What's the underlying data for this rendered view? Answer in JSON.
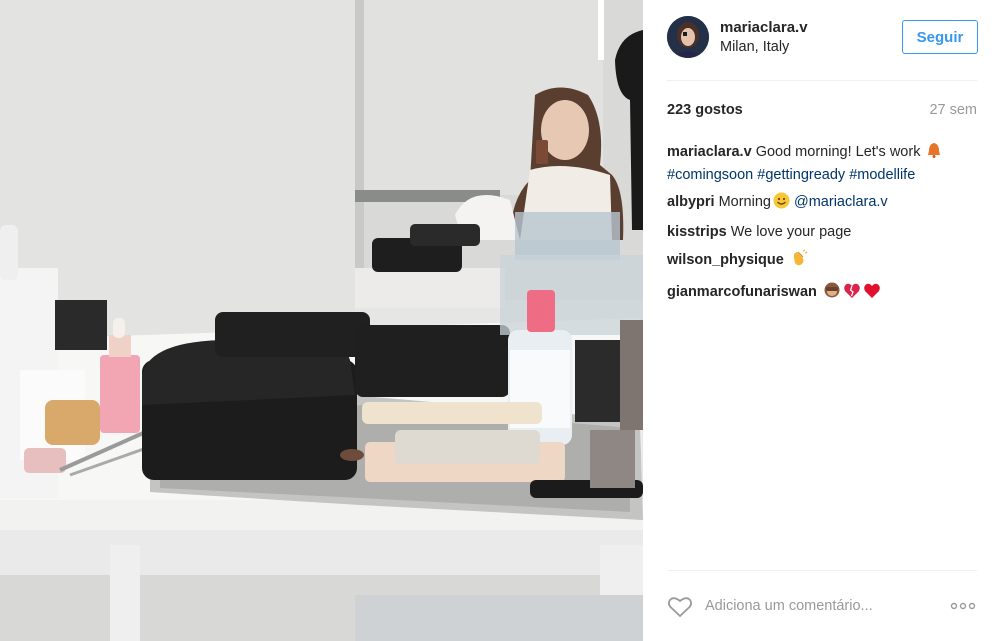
{
  "post": {
    "author": {
      "username": "mariaclara.v",
      "location": "Milan, Italy"
    },
    "follow_label": "Seguir",
    "likes_text": "223 gostos",
    "time_ago": "27 sem",
    "caption": {
      "user": "mariaclara.v",
      "text": "Good morning! Let's work",
      "hashtags": [
        "#comingsoon",
        "#getting­ready",
        "#modellife"
      ]
    },
    "comments": [
      {
        "user": "albypri",
        "text": "Morning",
        "mention": "@mariaclara.v"
      },
      {
        "user": "kisstrips",
        "text": "We love your page"
      },
      {
        "user": "wilson_physique",
        "text": ""
      },
      {
        "user": "gianmarcofunariswan",
        "text": ""
      }
    ],
    "add_comment_placeholder": "Adiciona um comentário...",
    "more_label": "•••"
  },
  "icons": {
    "avatar": "avatar-image",
    "like": "heart-outline-icon",
    "more": "more-options-icon",
    "caption_emoji": "bell-emoji",
    "albypri_emoji": "smiley-emoji",
    "wilson_emoji": "clapping-hands-emoji",
    "gian_emojis": [
      "monkey-emoji",
      "broken-heart-emoji",
      "red-heart-emoji"
    ]
  },
  "colors": {
    "accent": "#3897f0",
    "hashtag": "#003569",
    "muted": "#999999",
    "text": "#262626"
  }
}
